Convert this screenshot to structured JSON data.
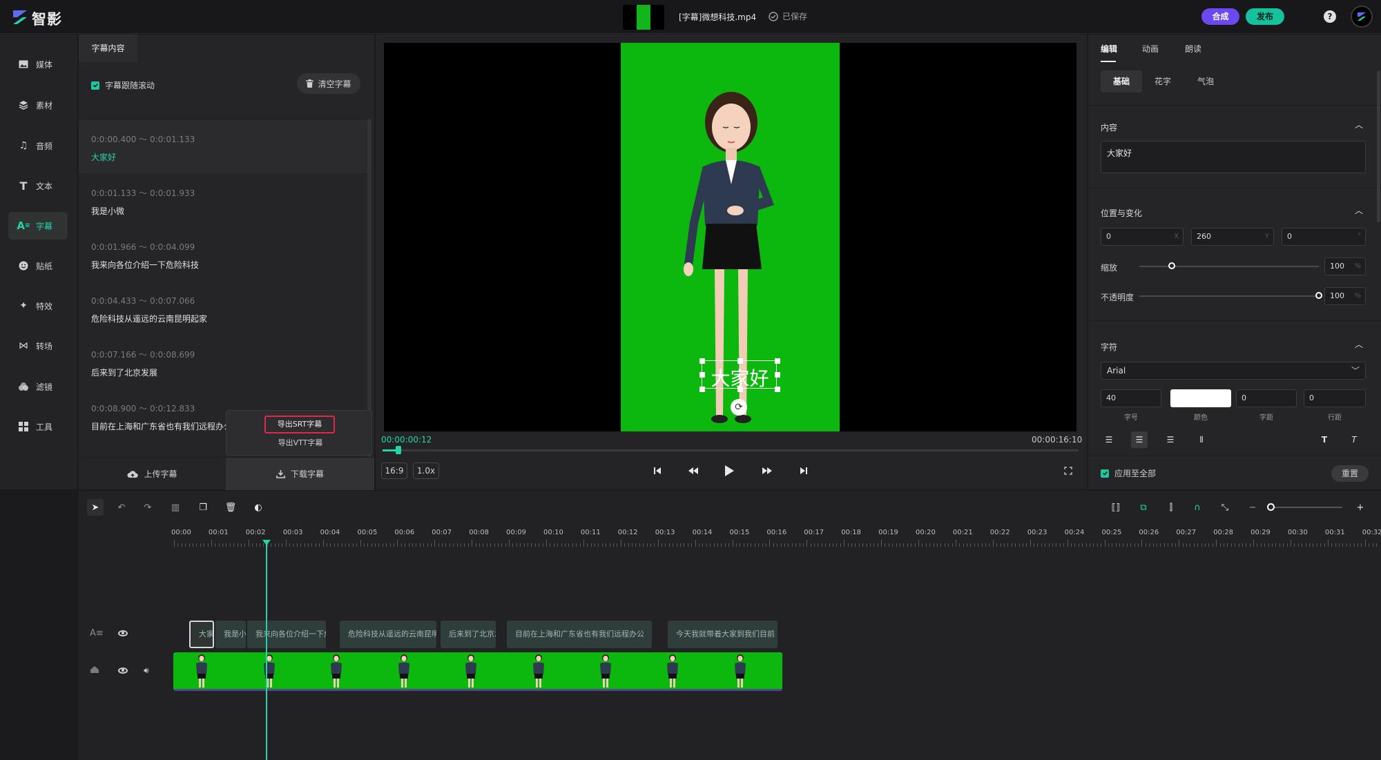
{
  "app": {
    "name": "智影",
    "file_title": "[字幕]微想科技.mp4",
    "save_state": "已保存",
    "compose_label": "合成",
    "publish_label": "发布",
    "help_glyph": "?"
  },
  "nav": {
    "items": [
      {
        "label": "媒体",
        "icon": "image-icon"
      },
      {
        "label": "素材",
        "icon": "layers-icon"
      },
      {
        "label": "音频",
        "icon": "music-note-icon"
      },
      {
        "label": "文本",
        "icon": "text-T-icon"
      },
      {
        "label": "字幕",
        "icon": "subtitle-icon",
        "active": true
      },
      {
        "label": "贴纸",
        "icon": "sticker-smile-icon"
      },
      {
        "label": "特效",
        "icon": "sparkle-icon"
      },
      {
        "label": "转场",
        "icon": "transition-bowtie-icon"
      },
      {
        "label": "滤镜",
        "icon": "filter-circles-icon"
      },
      {
        "label": "工具",
        "icon": "tools-grid-icon"
      }
    ]
  },
  "subtitle_panel": {
    "tab_label": "字幕内容",
    "follow_scroll_label": "字幕跟随滚动",
    "follow_scroll_checked": true,
    "clear_label": "清空字幕",
    "items": [
      {
        "time": "0:0:00.400 ～ 0:0:01.133",
        "text": "大家好",
        "active": true
      },
      {
        "time": "0:0:01.133 ～ 0:0:01.933",
        "text": "我是小微"
      },
      {
        "time": "0:0:01.966 ～ 0:0:04.099",
        "text": "我来向各位介绍一下危险科技"
      },
      {
        "time": "0:0:04.433 ～ 0:0:07.066",
        "text": "危险科技从遥远的云南昆明起家"
      },
      {
        "time": "0:0:07.166 ～ 0:0:08.699",
        "text": "后来到了北京发展"
      },
      {
        "time": "0:0:08.900 ～ 0:0:12.833",
        "text": "目前在上海和广东省也有我们远程办公"
      }
    ],
    "upload_label": "上传字幕",
    "download_label": "下载字幕",
    "export_menu": {
      "srt_label": "导出SRT字幕",
      "vtt_label": "导出VTT字幕"
    }
  },
  "preview": {
    "caption_text": "大家好",
    "current_time": "00:00:00:12",
    "total_time": "00:00:16:10",
    "progress_fraction": 0.023,
    "aspect_label": "16:9",
    "speed_label": "1.0x"
  },
  "right_panel": {
    "tabs": [
      "编辑",
      "动画",
      "朗读"
    ],
    "subtabs": [
      "基础",
      "花字",
      "气泡"
    ],
    "content_section": "内容",
    "content_value": "大家好",
    "position_section": "位置与变化",
    "pos_x": "0",
    "pos_y": "260",
    "pos_rot": "0",
    "pos_x_suffix": "X",
    "pos_y_suffix": "Y",
    "pos_rot_suffix": "°",
    "scale_label": "缩放",
    "scale_value": "100",
    "scale_fraction": 0.18,
    "opacity_label": "不透明度",
    "opacity_value": "100",
    "opacity_fraction": 1.0,
    "percent_suffix": "%",
    "char_section": "字符",
    "font_value": "Arial",
    "font_size": "40",
    "letter_spacing": "0",
    "line_spacing": "0",
    "font_size_caption": "字号",
    "color_caption": "颜色",
    "spacing_caption": "字距",
    "line_caption": "行距",
    "text_color": "#ffffff",
    "apply_all_label": "应用至全部",
    "apply_all_checked": true,
    "reset_label": "重置"
  },
  "timeline": {
    "ticks": [
      "00:00",
      "00:01",
      "00:02",
      "00:03",
      "00:04",
      "00:05",
      "00:06",
      "00:07",
      "00:08",
      "00:09",
      "00:10",
      "00:11",
      "00:12",
      "00:13",
      "00:14",
      "00:15",
      "00:16",
      "00:17",
      "00:18",
      "00:19",
      "00:20",
      "00:21",
      "00:22",
      "00:23",
      "00:24",
      "00:25",
      "00:26",
      "00:27",
      "00:28",
      "00:29",
      "00:30",
      "00:31",
      "00:32"
    ],
    "subtitle_clips": [
      "大家好",
      "我是小微",
      "我来向各位介绍一下危险科技",
      "危险科技从遥远的云南昆明起家",
      "后来到了北京发展",
      "目前在上海和广东省也有我们远程办公",
      "今天我就带着大家到我们目前"
    ]
  },
  "colors": {
    "accent": "#22d6a8",
    "compose": "#6c48f0",
    "publish": "#14c39e",
    "chroma_green": "#0cb80e",
    "export_highlight": "#e5254a"
  }
}
